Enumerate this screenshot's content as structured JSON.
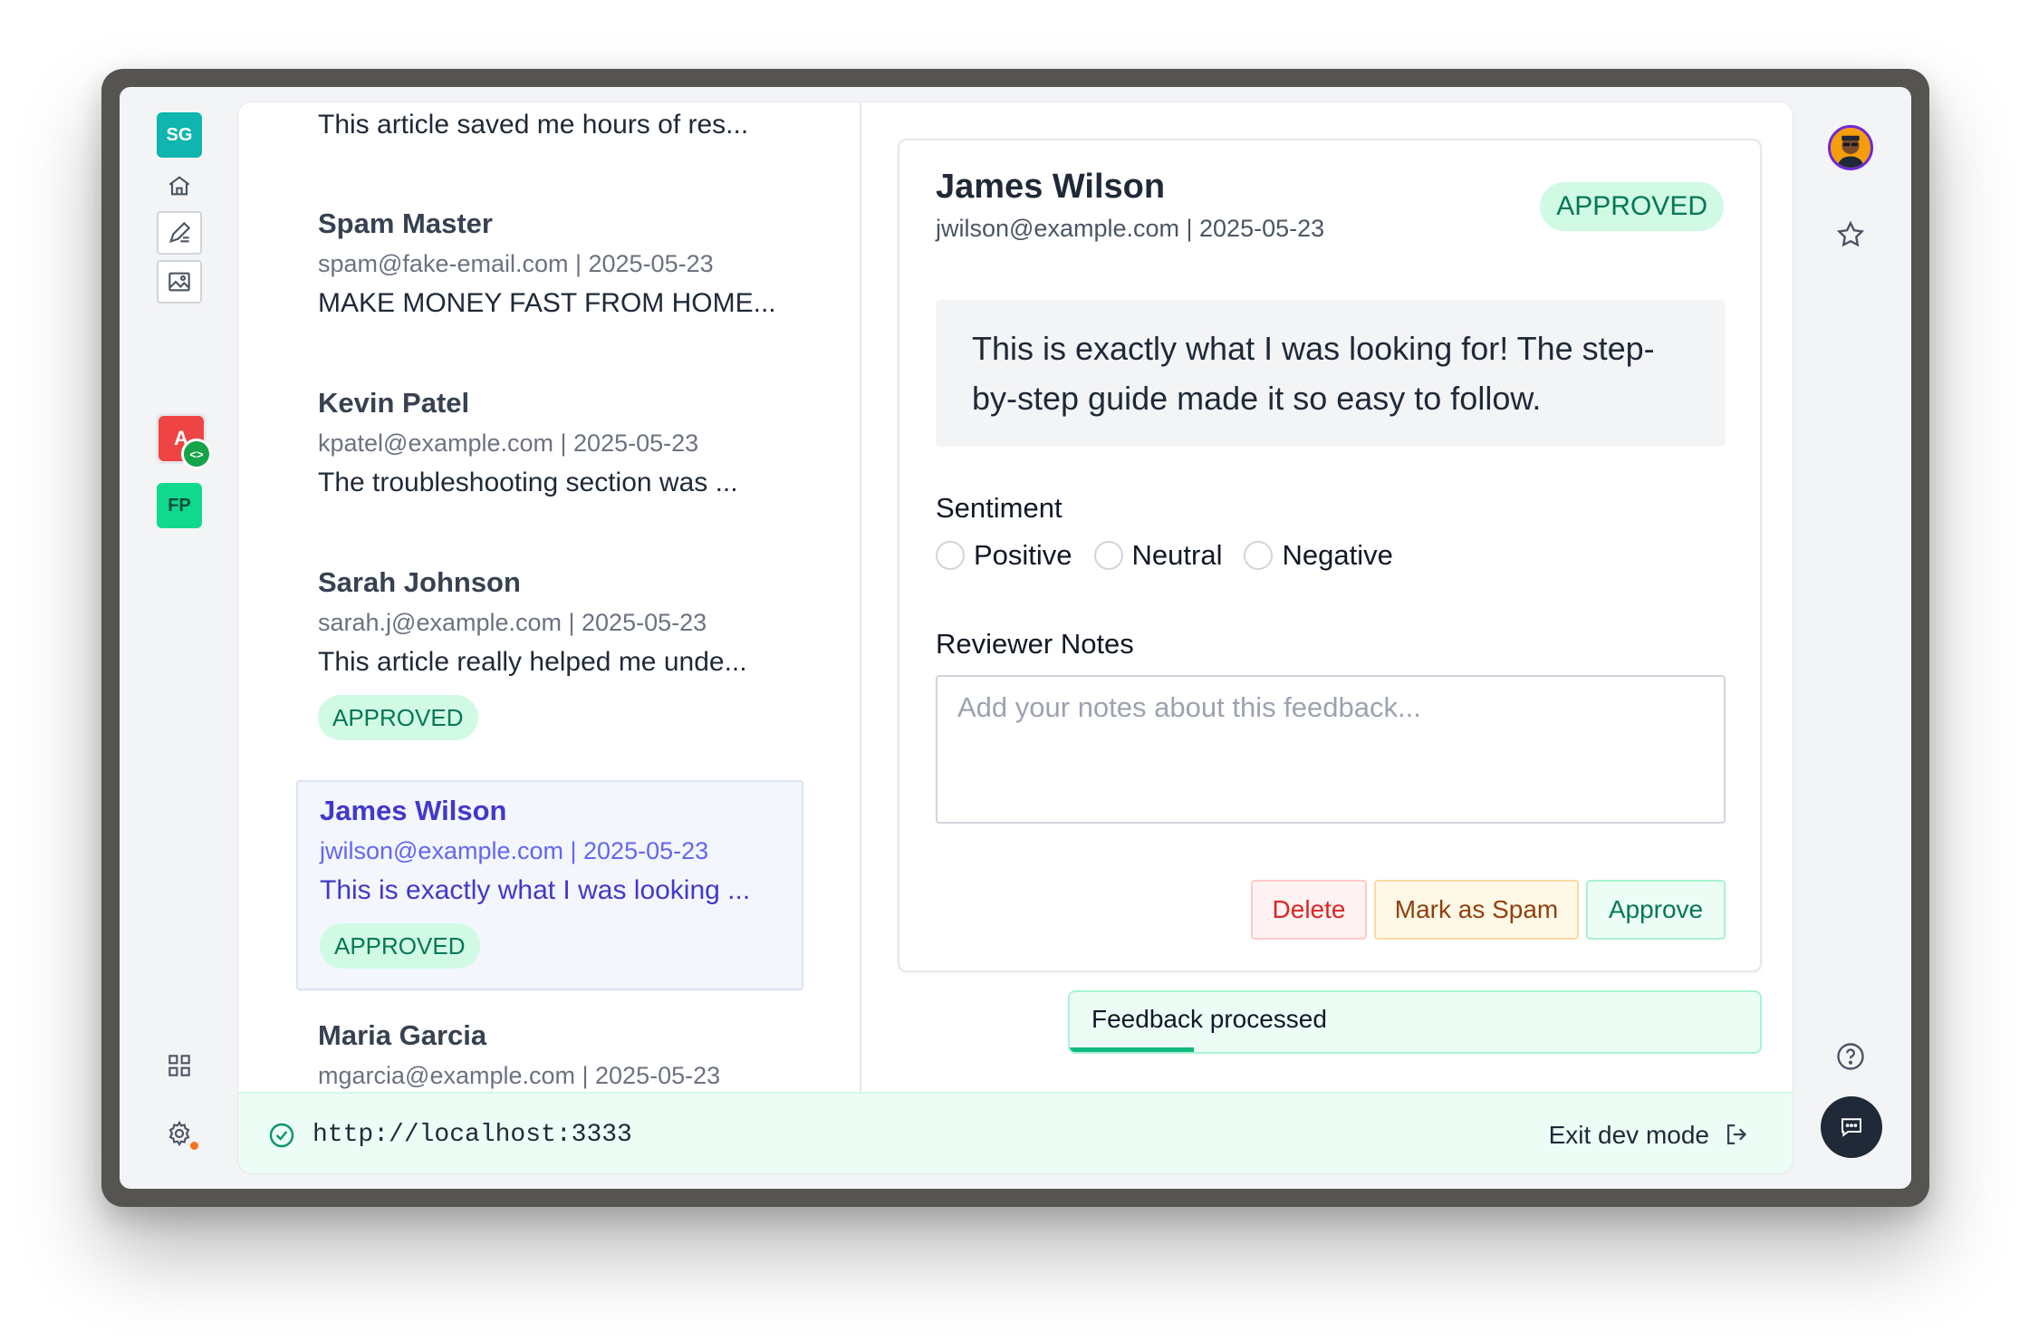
{
  "rail": {
    "badges": [
      {
        "label": "SG",
        "color": "#0fb5ae"
      },
      {
        "label": "FP",
        "color": "#10d98e"
      }
    ],
    "app_a_label": "A",
    "app_a_overlay": "<>"
  },
  "list": {
    "items": [
      {
        "name": "",
        "meta": "",
        "text": "This article saved me hours of res...",
        "status": ""
      },
      {
        "name": "Spam Master",
        "meta": "spam@fake-email.com | 2025-05-23",
        "text": "MAKE MONEY FAST FROM HOME...",
        "status": ""
      },
      {
        "name": "Kevin Patel",
        "meta": "kpatel@example.com | 2025-05-23",
        "text": "The troubleshooting section was ...",
        "status": ""
      },
      {
        "name": "Sarah Johnson",
        "meta": "sarah.j@example.com | 2025-05-23",
        "text": "This article really helped me unde...",
        "status": "APPROVED"
      },
      {
        "name": "James Wilson",
        "meta": "jwilson@example.com | 2025-05-23",
        "text": "This is exactly what I was looking ...",
        "status": "APPROVED"
      },
      {
        "name": "Maria Garcia",
        "meta": "mgarcia@example.com | 2025-05-23",
        "text": "",
        "status": ""
      }
    ]
  },
  "detail": {
    "name": "James Wilson",
    "meta": "jwilson@example.com | 2025-05-23",
    "status": "APPROVED",
    "quote": "This is exactly what I was looking for! The step-by-step guide made it so easy to follow.",
    "sentiment_label": "Sentiment",
    "sentiments": [
      "Positive",
      "Neutral",
      "Negative"
    ],
    "notes_label": "Reviewer Notes",
    "notes_placeholder": "Add your notes about this feedback...",
    "buttons": {
      "delete": "Delete",
      "spam": "Mark as Spam",
      "approve": "Approve"
    }
  },
  "toast": {
    "text": "Feedback processed",
    "progress": 0.18
  },
  "dev_bar": {
    "url": "http://localhost:3333",
    "exit_label": "Exit dev mode"
  },
  "colors": {
    "accent": "#4338ca",
    "success": "#047857",
    "danger": "#dc2626",
    "warning": "#92400e"
  }
}
